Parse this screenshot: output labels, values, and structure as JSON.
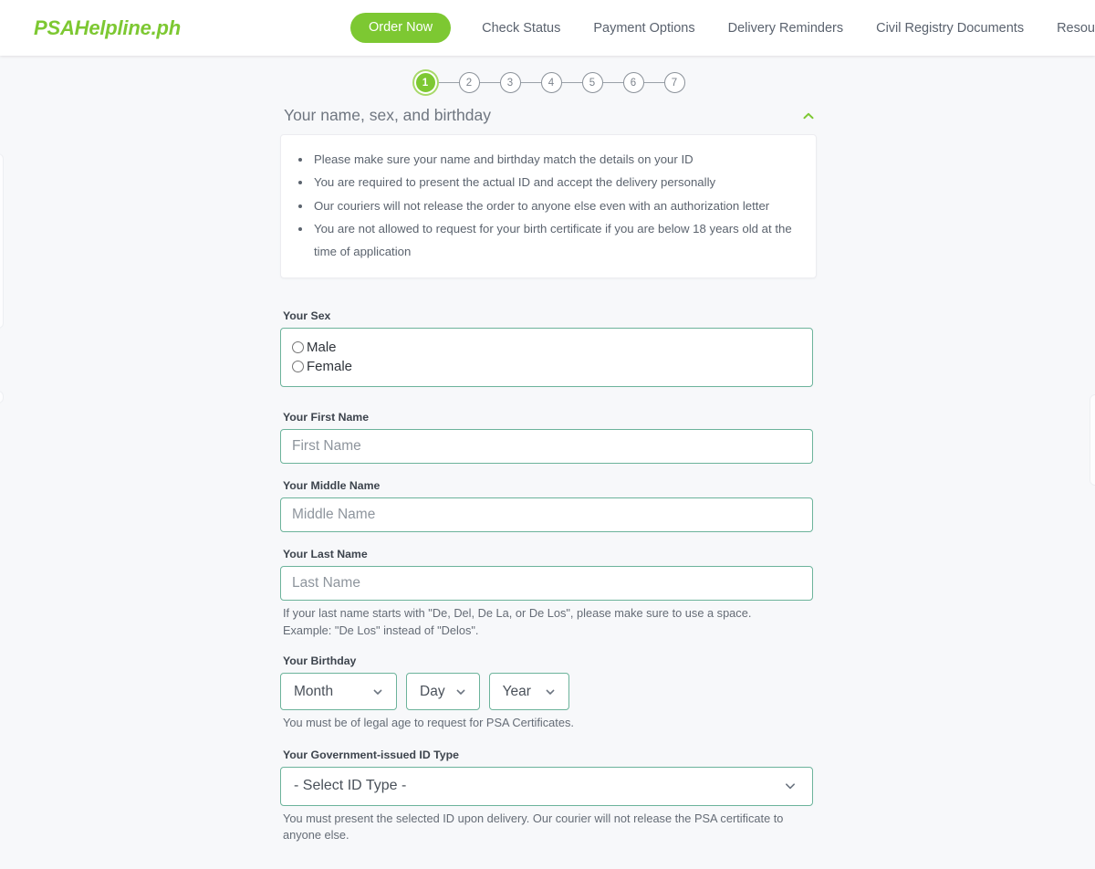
{
  "header": {
    "brand": "PSAHelpline.ph",
    "cta_label": "Order Now",
    "nav_links": [
      "Check Status",
      "Payment Options",
      "Delivery Reminders",
      "Civil Registry Documents",
      "Resources"
    ]
  },
  "stepper": {
    "steps": [
      "1",
      "2",
      "3",
      "4",
      "5",
      "6",
      "7"
    ],
    "active_index": 0,
    "active_color": "#7dc832",
    "inactive_color": "#8a9199"
  },
  "section": {
    "title": "Your name, sex, and birthday",
    "collapse_icon": "chevron-up-icon",
    "collapse_icon_color": "#7dc832"
  },
  "instructions": [
    "Please make sure your name and birthday match the details on your ID",
    "You are required to present the actual ID and accept the delivery personally",
    "Our couriers will not release the order to anyone else even with an authorization letter",
    "You are not allowed to request for your birth certificate if you are below 18 years old at the time of application"
  ],
  "form": {
    "sex": {
      "label": "Your Sex",
      "options": [
        {
          "label": "Male",
          "checked": false
        },
        {
          "label": "Female",
          "checked": false
        }
      ]
    },
    "first_name": {
      "label": "Your First Name",
      "placeholder": "First Name",
      "value": ""
    },
    "middle_name": {
      "label": "Your Middle Name",
      "placeholder": "Middle Name",
      "value": ""
    },
    "last_name": {
      "label": "Your Last Name",
      "placeholder": "Last Name",
      "value": "",
      "helper": "If your last name starts with \"De, Del, De La, or De Los\", please make sure to use a space. Example: \"De Los\" instead of \"Delos\"."
    },
    "birthday": {
      "label": "Your Birthday",
      "month_value": "Month",
      "day_value": "Day",
      "year_value": "Year",
      "helper": "You must be of legal age to request for PSA Certificates."
    },
    "id_type": {
      "label": "Your Government-issued ID Type",
      "value": "- Select ID Type -",
      "helper": "You must present the selected ID upon delivery. Our courier will not release the PSA certificate to anyone else."
    }
  },
  "theme": {
    "brand_green": "#7dc832",
    "field_border": "#6cb39b",
    "page_background": "#f7f8fa"
  }
}
